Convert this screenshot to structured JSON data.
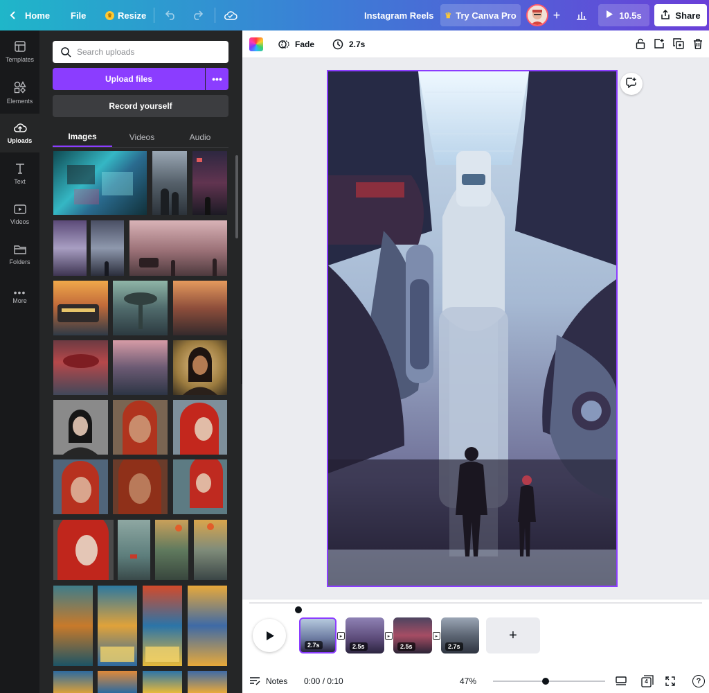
{
  "topbar": {
    "home_label": "Home",
    "file_label": "File",
    "resize_label": "Resize",
    "doc_title": "Instagram Reels",
    "try_pro_label": "Try Canva Pro",
    "duration_label": "10.5s",
    "share_label": "Share"
  },
  "rail": {
    "items": [
      {
        "label": "Templates",
        "icon": "templates-icon"
      },
      {
        "label": "Elements",
        "icon": "elements-icon"
      },
      {
        "label": "Uploads",
        "icon": "cloud-upload-icon"
      },
      {
        "label": "Text",
        "icon": "text-icon"
      },
      {
        "label": "Videos",
        "icon": "video-icon"
      },
      {
        "label": "Folders",
        "icon": "folder-icon"
      },
      {
        "label": "More",
        "icon": "more-icon"
      }
    ]
  },
  "panel": {
    "search_placeholder": "Search uploads",
    "upload_label": "Upload files",
    "upload_more_label": "•••",
    "record_label": "Record yourself",
    "tabs": [
      "Images",
      "Videos",
      "Audio"
    ]
  },
  "canvas_toolbar": {
    "transition_label": "Fade",
    "duration_label": "2.7s"
  },
  "timeline": {
    "clips": [
      {
        "duration": "2.7s"
      },
      {
        "duration": "2.5s"
      },
      {
        "duration": "2.5s"
      },
      {
        "duration": "2.7s"
      }
    ],
    "add_label": "+"
  },
  "bottom_bar": {
    "notes_label": "Notes",
    "time_label": "0:00 / 0:10",
    "zoom_label": "47%",
    "zoom_fraction": 0.47,
    "page_count": "4",
    "help_label": "?"
  },
  "colors": {
    "accent": "#8b3dff",
    "rail_bg": "#18191b",
    "panel_bg": "#252627"
  }
}
